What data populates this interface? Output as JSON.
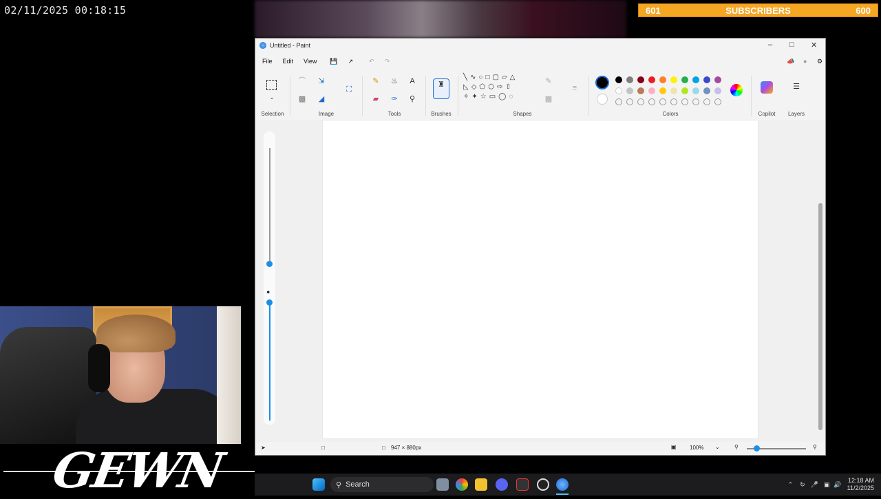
{
  "overlay": {
    "clock": "02/11/2025 00:18:15",
    "subscribers": {
      "current": "601",
      "label": "SUBSCRIBERS",
      "goal": "600"
    },
    "brand": "GEWN"
  },
  "window": {
    "title": "Untitled - Paint",
    "menus": [
      "File",
      "Edit",
      "View"
    ],
    "groups": {
      "selection": "Selection",
      "image": "Image",
      "tools": "Tools",
      "brushes": "Brushes",
      "shapes": "Shapes",
      "colors": "Colors",
      "copilot": "Copilot",
      "layers": "Layers"
    },
    "colors": {
      "primary": "#000000",
      "secondary": "#ffffff",
      "row1": [
        "#000000",
        "#7f7f7f",
        "#880015",
        "#ed1c24",
        "#ff7f27",
        "#fff200",
        "#22b14c",
        "#00a2e8",
        "#3f48cc",
        "#a349a4"
      ],
      "row2": [
        "#ffffff",
        "#c3c3c3",
        "#b97a57",
        "#ffaec9",
        "#ffc90e",
        "#efe4b0",
        "#b5e61d",
        "#99d9ea",
        "#7092be",
        "#c8bfe7"
      ]
    },
    "status": {
      "canvas_size": "947 × 880px",
      "zoom": "100%"
    }
  },
  "taskbar": {
    "search_placeholder": "Search",
    "time": "12:18 AM",
    "date": "11/2/2025"
  }
}
